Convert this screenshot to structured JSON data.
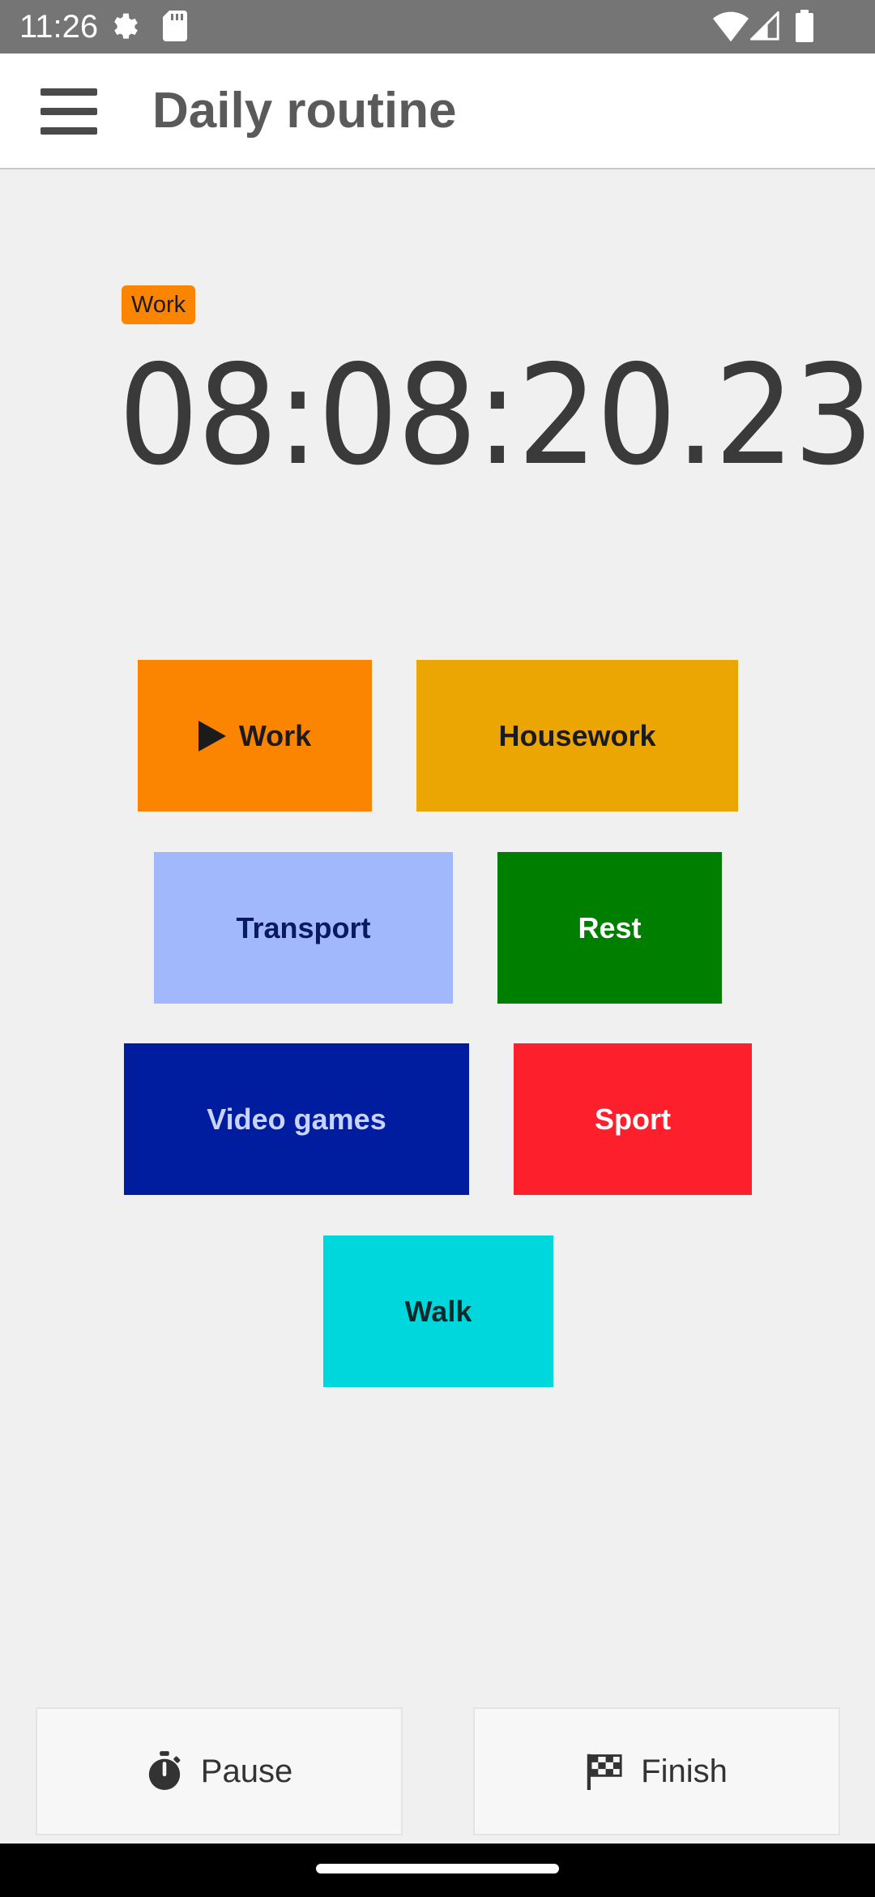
{
  "status_bar": {
    "time": "11:26",
    "icons": [
      "gear-icon",
      "sd-card-icon",
      "wifi-icon",
      "signal-icon",
      "battery-icon"
    ]
  },
  "app_bar": {
    "title": "Daily routine",
    "menu_icon": "hamburger-menu-icon"
  },
  "current": {
    "activity_label": "Work",
    "activity_color": "#fb8500",
    "elapsed": "08:08:20.23"
  },
  "activities": [
    {
      "label": "Work",
      "bg": "#fb8500",
      "fg": "#1b1b1b",
      "active": true,
      "icon": "play-icon"
    },
    {
      "label": "Housework",
      "bg": "#eba604",
      "fg": "#1b1b1b",
      "active": false
    },
    {
      "label": "Transport",
      "bg": "#a2b8fd",
      "fg": "#0a1a5e",
      "active": false
    },
    {
      "label": "Rest",
      "bg": "#007e00",
      "fg": "#ffffff",
      "active": false
    },
    {
      "label": "Video games",
      "bg": "#001c9f",
      "fg": "#c9d3ff",
      "active": false
    },
    {
      "label": "Sport",
      "bg": "#fe1f2c",
      "fg": "#ffffff",
      "active": false
    },
    {
      "label": "Walk",
      "bg": "#00d7dc",
      "fg": "#0b2a2b",
      "active": false
    }
  ],
  "actions": {
    "pause_label": "Pause",
    "pause_icon": "stopwatch-icon",
    "finish_label": "Finish",
    "finish_icon": "checkered-flag-icon"
  }
}
